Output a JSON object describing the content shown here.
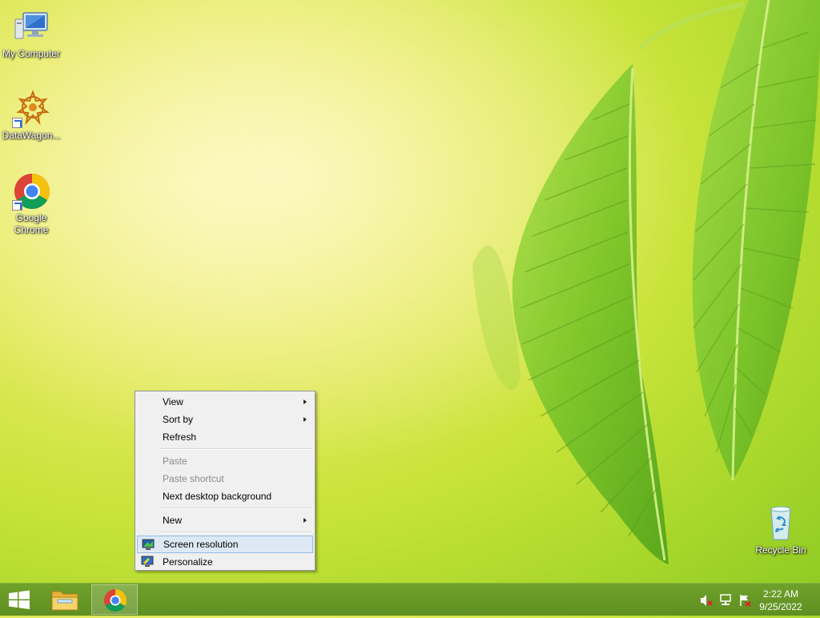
{
  "desktop": {
    "icons": [
      {
        "label": "My Computer"
      },
      {
        "label": "DataWagon..."
      },
      {
        "label": "Google Chrome"
      },
      {
        "label": "Recycle Bin"
      }
    ]
  },
  "context_menu": {
    "items": [
      {
        "label": "View",
        "submenu": true
      },
      {
        "label": "Sort by",
        "submenu": true
      },
      {
        "label": "Refresh"
      },
      {
        "label": "Paste",
        "disabled": true
      },
      {
        "label": "Paste shortcut",
        "disabled": true
      },
      {
        "label": "Next desktop background"
      },
      {
        "label": "New",
        "submenu": true
      },
      {
        "label": "Screen resolution",
        "highlighted": true,
        "icon": "display-icon"
      },
      {
        "label": "Personalize",
        "icon": "personalize-icon"
      }
    ]
  },
  "taskbar": {
    "buttons": [
      {
        "name": "start-button",
        "icon": "windows-logo-icon"
      },
      {
        "name": "file-explorer",
        "icon": "folder-icon"
      },
      {
        "name": "google-chrome",
        "icon": "chrome-icon",
        "active": true
      }
    ],
    "tray": {
      "icons": [
        "volume-muted-icon",
        "network-icon",
        "action-center-icon"
      ],
      "time": "2:22 AM",
      "date": "9/25/2022"
    }
  },
  "colors": {
    "taskbar": "#649626",
    "menu_bg": "#f0f0f0",
    "menu_highlight": "#dce9f5"
  }
}
